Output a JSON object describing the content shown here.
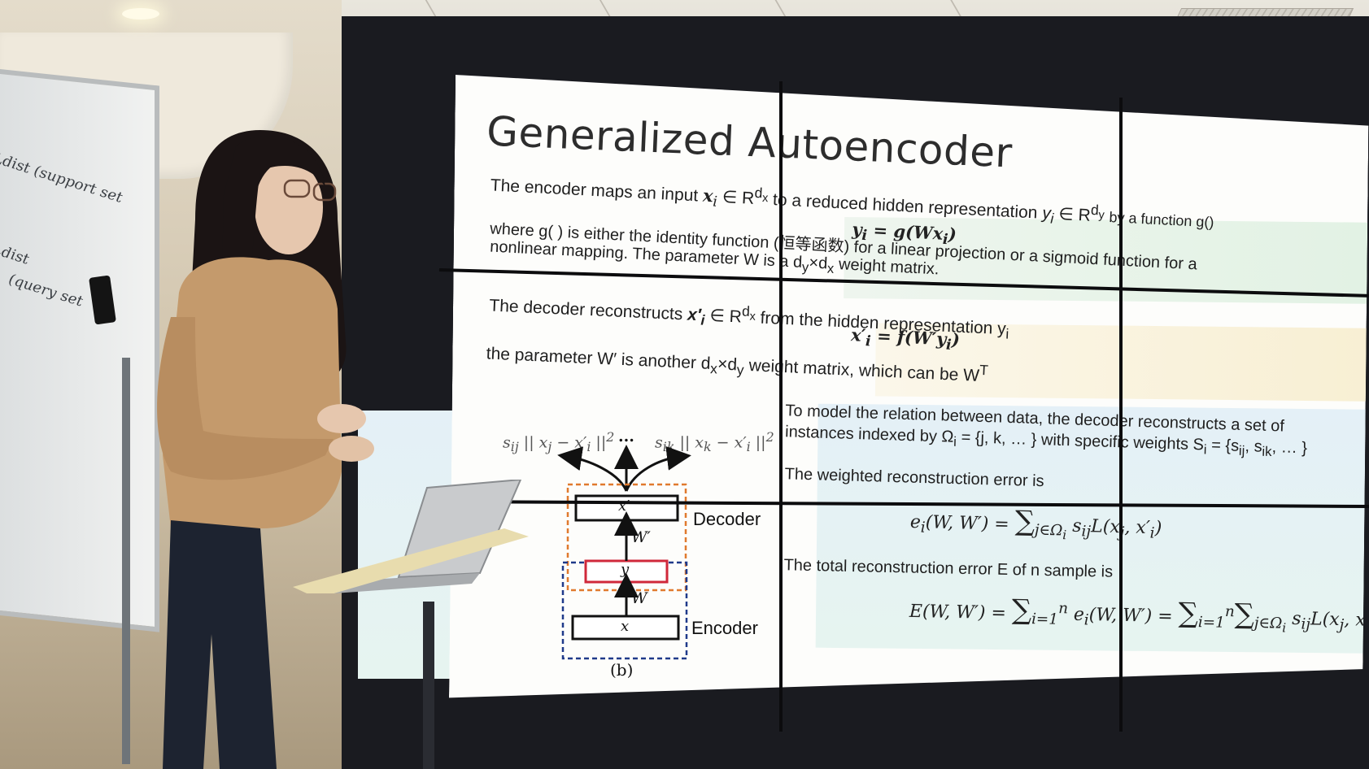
{
  "slide": {
    "title": "Generalized Autoencoder",
    "encoder_line1_text": "The encoder maps an input",
    "encoder_line1_math": "x",
    "encoder_line1_mid": "∈ R",
    "encoder_line1_rest": "to a reduced hidden representation",
    "encoder_line1_by": "by a function g()",
    "encoder_formula": "y",
    "encoder_line2a": "where g( ) is either the identity function (恒等函数) for a linear projection or a sigmoid function for a",
    "encoder_line2b": "nonlinear mapping. The parameter W is a d",
    "encoder_line2b_tail": "×d",
    "encoder_line2b_end": "weight matrix.",
    "decoder_line1": "The decoder reconstructs",
    "decoder_line1_rest": "from the hidden representation y",
    "decoder_formula": "= f(W′y",
    "decoder_line2": "the parameter W′ is another d",
    "decoder_line2_rest": "weight matrix, which can be W",
    "relation_line1": "To model the relation between data, the decoder reconstructs a set of",
    "relation_line2": "instances indexed by Ω",
    "relation_line2_mid": "= {j, k, … } with specific weights S",
    "relation_line2_end": "= {s",
    "weighted_error_line": "The weighted reconstruction error is",
    "weighted_error_formula": "e",
    "total_error_line": "The total reconstruction error E of n sample is",
    "total_error_formula": "E(W, W′) =",
    "diagram": {
      "top_left_math": "s",
      "top_dots": "...",
      "top_right_math": "s",
      "decoder_label": "Decoder",
      "encoder_label": "Encoder",
      "w_prime": "W′",
      "w": "W",
      "box_top": "x′",
      "box_mid": "y",
      "box_bottom": "x",
      "caption": "(b)"
    }
  },
  "whiteboard": {
    "scribble1": "Ldist (support set",
    "scribble2": "Ldist",
    "scribble3": "(query set"
  },
  "colors": {
    "band_green": "#e2f2e4",
    "band_yellow": "#f8efd3",
    "band_blue": "#e4f0f7",
    "decoder_box_border": "#e07a2e",
    "encoder_box_border": "#1f3a8a",
    "hidden_box_border": "#d0283a"
  }
}
